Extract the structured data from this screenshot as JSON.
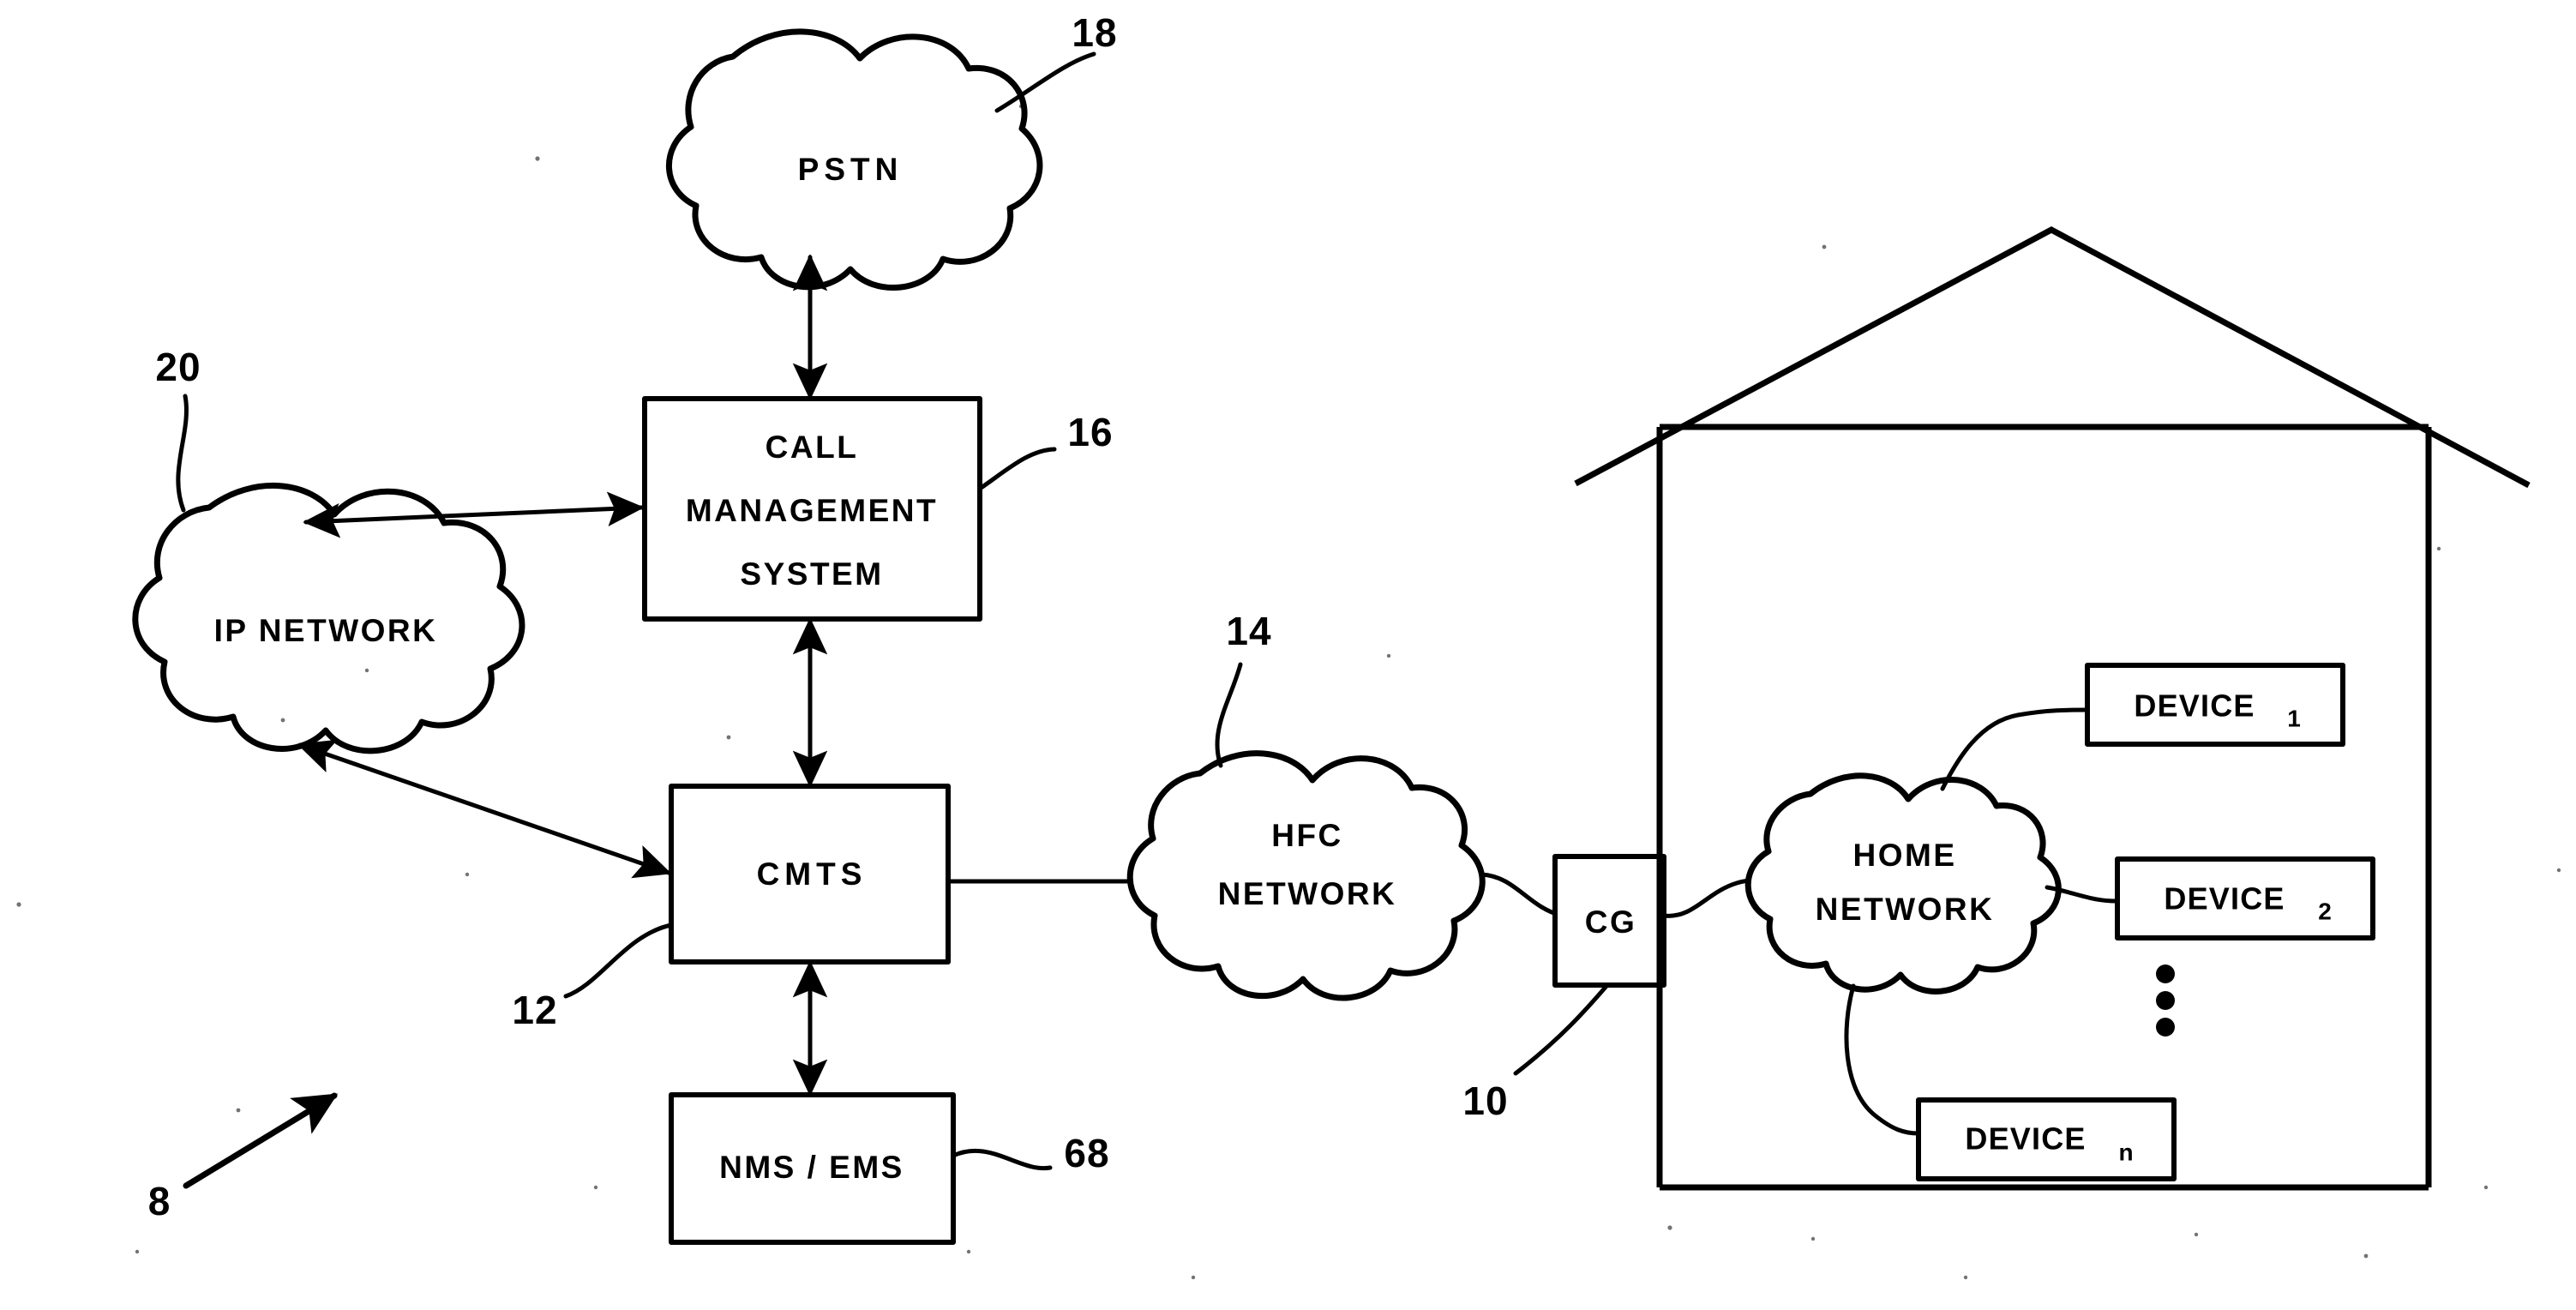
{
  "figure": {
    "title": "",
    "type": "patent-network-diagram",
    "reference_numeral_overall": "8"
  },
  "nodes": {
    "pstn": {
      "label": "PSTN",
      "ref": "18",
      "shape": "cloud"
    },
    "ip_network": {
      "label": "IP NETWORK",
      "ref": "20",
      "shape": "cloud"
    },
    "call_management_system": {
      "line1": "CALL",
      "line2": "MANAGEMENT",
      "line3": "SYSTEM",
      "ref": "16",
      "shape": "box"
    },
    "cmts": {
      "label": "CMTS",
      "ref": "12",
      "shape": "box"
    },
    "nms_ems": {
      "label": "NMS / EMS",
      "ref": "68",
      "shape": "box"
    },
    "hfc_network": {
      "line1": "HFC",
      "line2": "NETWORK",
      "ref": "14",
      "shape": "cloud"
    },
    "cg": {
      "label": "CG",
      "ref": "10",
      "shape": "box"
    },
    "home_network": {
      "line1": "HOME",
      "line2": "NETWORK",
      "ref": "",
      "shape": "cloud"
    },
    "house": {
      "label": "",
      "ref": "",
      "shape": "house-outline"
    }
  },
  "devices": [
    {
      "label": "DEVICE",
      "subscript": "1",
      "name": "device-1"
    },
    {
      "label": "DEVICE",
      "subscript": "2",
      "name": "device-2"
    },
    {
      "label": "DEVICE",
      "subscript": "n",
      "name": "device-n"
    }
  ],
  "ellipsis": {
    "glyph": "•",
    "count": 3,
    "orientation": "vertical"
  },
  "connections": [
    {
      "from": "call_management_system",
      "to": "pstn",
      "style": "double-arrow-vertical"
    },
    {
      "from": "call_management_system",
      "to": "ip_network",
      "style": "double-arrow"
    },
    {
      "from": "call_management_system",
      "to": "cmts",
      "style": "double-arrow-vertical"
    },
    {
      "from": "cmts",
      "to": "ip_network",
      "style": "double-arrow"
    },
    {
      "from": "cmts",
      "to": "nms_ems",
      "style": "double-arrow-vertical"
    },
    {
      "from": "cmts",
      "to": "hfc_network",
      "style": "plain-line"
    },
    {
      "from": "hfc_network",
      "to": "cg",
      "style": "plain-curve"
    },
    {
      "from": "cg",
      "to": "home_network",
      "style": "plain-curve"
    },
    {
      "from": "home_network",
      "to": "device-1",
      "style": "plain-curve"
    },
    {
      "from": "home_network",
      "to": "device-2",
      "style": "plain-curve"
    },
    {
      "from": "home_network",
      "to": "device-n",
      "style": "plain-curve"
    }
  ],
  "colors": {
    "ink": "#000000",
    "paper": "#ffffff"
  }
}
